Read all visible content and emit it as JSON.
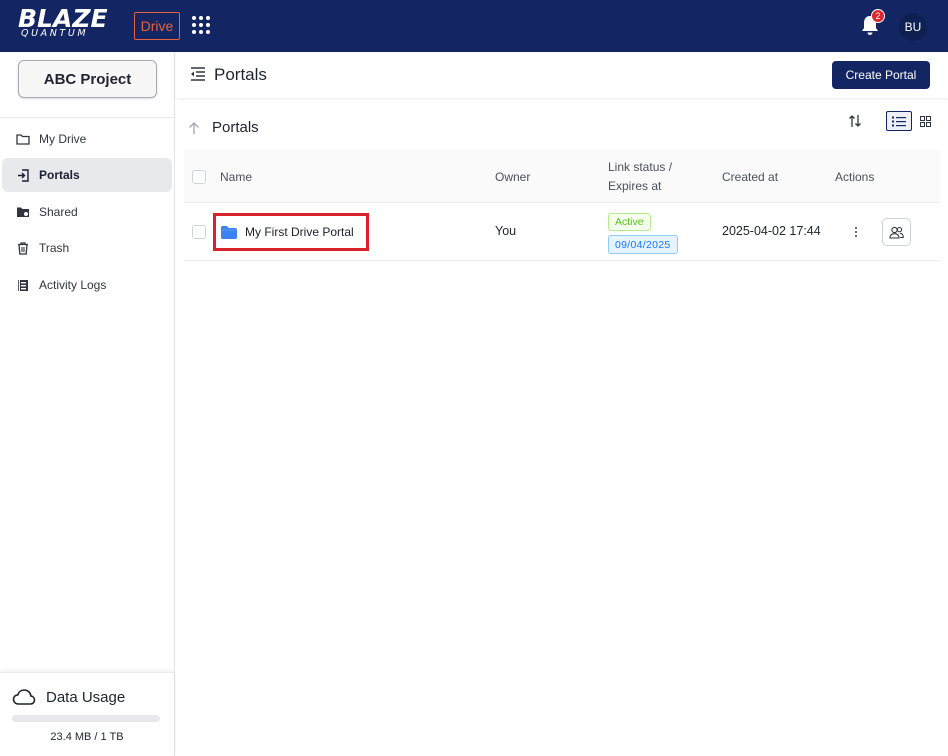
{
  "header": {
    "logo_main": "BLAZE",
    "logo_sub": "QUANTUM",
    "app_badge": "Drive",
    "notification_count": "2",
    "avatar_initials": "BU"
  },
  "sidebar": {
    "project_button": "ABC Project",
    "items": [
      {
        "label": "My Drive",
        "icon": "folder-outline-icon",
        "active": false
      },
      {
        "label": "Portals",
        "icon": "portal-enter-icon",
        "active": true
      },
      {
        "label": "Shared",
        "icon": "shared-folder-icon",
        "active": false
      },
      {
        "label": "Trash",
        "icon": "trash-icon",
        "active": false
      },
      {
        "label": "Activity Logs",
        "icon": "activity-log-icon",
        "active": false
      }
    ],
    "usage": {
      "title": "Data Usage",
      "text": "23.4 MB / 1 TB",
      "fraction": 0.0
    }
  },
  "main": {
    "page_title": "Portals",
    "create_button": "Create Portal",
    "section_title": "Portals",
    "table": {
      "columns": {
        "name": "Name",
        "owner": "Owner",
        "link_status_line1": "Link status /",
        "link_status_line2": "Expires at",
        "created_at": "Created at",
        "actions": "Actions"
      },
      "rows": [
        {
          "name": "My First Drive Portal",
          "owner": "You",
          "status": "Active",
          "expires": "09/04/2025",
          "created_at": "2025-04-02 17:44"
        }
      ]
    }
  },
  "colors": {
    "brand_navy": "#132663",
    "accent_orange": "#e7623b",
    "highlight_red": "#d8232a",
    "status_green": "#52c41a",
    "status_blue": "#1677ff",
    "folder_blue": "#3b82f6"
  }
}
